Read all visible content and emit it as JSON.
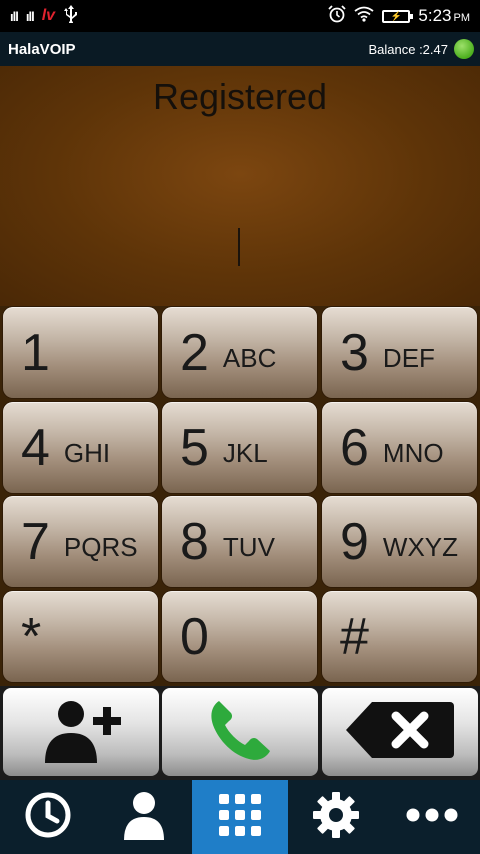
{
  "status_bar": {
    "carrier_badge": "lv",
    "time": "5:23",
    "ampm": "PM",
    "signal_1": "ıll",
    "signal_2": "ıll"
  },
  "app": {
    "title": "HalaVOIP",
    "balance_label": "Balance :2.47",
    "status_color": "#5cbf2a"
  },
  "display": {
    "status_text": "Registered",
    "number": ""
  },
  "keypad": {
    "keys": [
      {
        "digit": "1",
        "letters": ""
      },
      {
        "digit": "2",
        "letters": "ABC"
      },
      {
        "digit": "3",
        "letters": "DEF"
      },
      {
        "digit": "4",
        "letters": "GHI"
      },
      {
        "digit": "5",
        "letters": "JKL"
      },
      {
        "digit": "6",
        "letters": "MNO"
      },
      {
        "digit": "7",
        "letters": "PQRS"
      },
      {
        "digit": "8",
        "letters": "TUV"
      },
      {
        "digit": "9",
        "letters": "WXYZ"
      },
      {
        "digit": "*",
        "letters": ""
      },
      {
        "digit": "0",
        "letters": ""
      },
      {
        "digit": "#",
        "letters": ""
      }
    ]
  },
  "actions": {
    "icons": [
      "add-contact-icon",
      "call-icon",
      "backspace-icon"
    ],
    "call_color": "#2eaa3c"
  },
  "nav": {
    "icons": [
      "clock-icon",
      "person-icon",
      "dialpad-icon",
      "gear-icon",
      "more-icon"
    ],
    "active_index": 2,
    "active_color": "#1f7ec8"
  }
}
